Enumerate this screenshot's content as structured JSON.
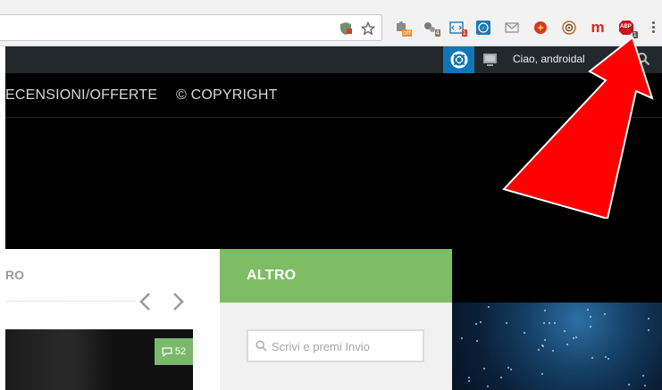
{
  "browser": {
    "address_bar": {
      "value": ""
    },
    "extensions": [
      {
        "name": "puzzle-extension-icon",
        "badge": "off",
        "badge_color": "#e6883a"
      },
      {
        "name": "gear-cluster-extension-icon",
        "badge": "4",
        "badge_color": "#8a7a52"
      },
      {
        "name": "code-extension-icon",
        "badge": "1",
        "badge_color": "#d43b2e"
      },
      {
        "name": "compass-extension-icon"
      },
      {
        "name": "mail-extension-icon"
      },
      {
        "name": "red-badge-extension-icon"
      },
      {
        "name": "target-extension-icon"
      },
      {
        "name": "m-letter-extension-icon",
        "glyph": "m"
      },
      {
        "name": "adblock-plus-extension-icon",
        "glyph": "ABP",
        "badge": "1",
        "badge_color": "#555555"
      }
    ]
  },
  "admin_bar": {
    "greeting": "Ciao, androidal"
  },
  "nav": {
    "items": [
      "ECENSIONI/OFFERTE",
      "© COPYRIGHT"
    ]
  },
  "left": {
    "title": "RO",
    "comment_count": "52"
  },
  "altro": {
    "title": "ALTRO",
    "search_placeholder": "Scrivi e premi Invio"
  },
  "colors": {
    "admin_bar": "#23282d",
    "accent_blue": "#0f76b8",
    "green": "#7ebd64",
    "annotation_red": "#ff0000"
  }
}
